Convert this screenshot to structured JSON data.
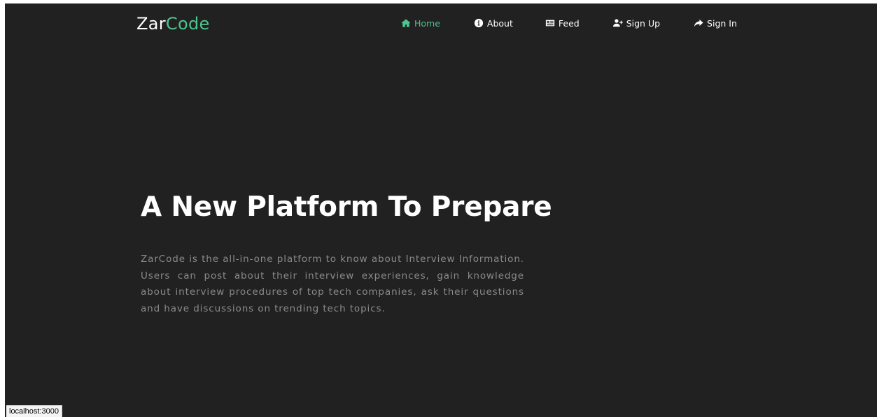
{
  "brand": {
    "name_part1": "Zar",
    "name_part2": "Code",
    "accent_color": "#4ec38f"
  },
  "nav": {
    "items": [
      {
        "label": "Home",
        "icon": "home-icon",
        "active": true
      },
      {
        "label": "About",
        "icon": "info-circle-icon",
        "active": false
      },
      {
        "label": "Feed",
        "icon": "newspaper-icon",
        "active": false
      },
      {
        "label": "Sign Up",
        "icon": "user-plus-icon",
        "active": false
      },
      {
        "label": "Sign In",
        "icon": "share-arrow-icon",
        "active": false
      }
    ]
  },
  "hero": {
    "title": "A New Platform To Prepare",
    "description": "ZarCode is the all-in-one platform to know about Interview Information. Users can post about their interview experiences, gain knowledge about interview procedures of top tech companies, ask their questions and have discussions on trending tech topics."
  },
  "status_bar": {
    "url": "localhost:3000"
  },
  "colors": {
    "background": "#212121",
    "text_primary": "#ffffff",
    "text_muted": "#8a8a8a"
  }
}
